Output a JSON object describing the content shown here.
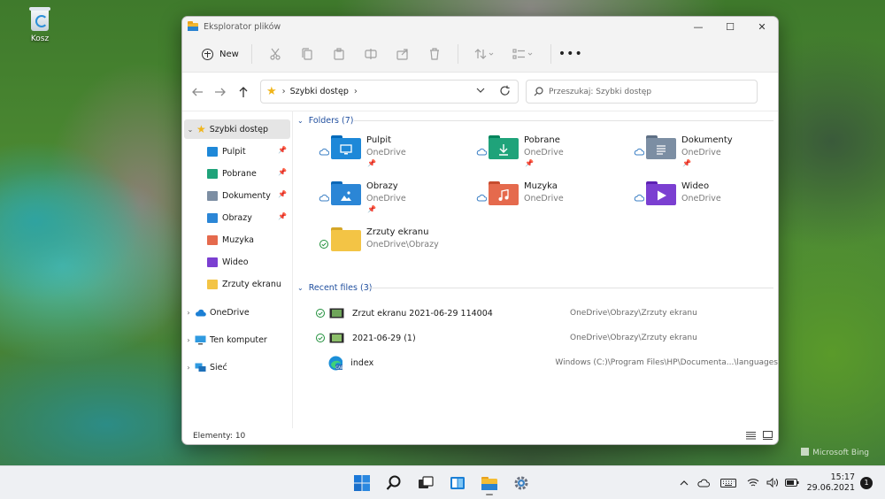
{
  "desktop": {
    "recycle_bin_label": "Kosz",
    "watermark": "Microsoft Bing"
  },
  "window": {
    "title": "Eksplorator plików",
    "controls": {
      "minimize": "—",
      "maximize": "☐",
      "close": "✕"
    }
  },
  "toolbar": {
    "new_label": "New",
    "more_label": "•••",
    "icons": [
      "cut-icon",
      "copy-icon",
      "paste-icon",
      "rename-icon",
      "share-icon",
      "delete-icon",
      "sort-icon",
      "view-icon"
    ]
  },
  "address": {
    "crumb": "Szybki dostęp",
    "search_placeholder": "Przeszukaj: Szybki dostęp"
  },
  "sidebar": {
    "quick_access": "Szybki dostęp",
    "items": [
      {
        "label": "Pulpit",
        "color": "#1e88d8",
        "pinned": true
      },
      {
        "label": "Pobrane",
        "color": "#1fa37a",
        "pinned": true
      },
      {
        "label": "Dokumenty",
        "color": "#7c8ea3",
        "pinned": true
      },
      {
        "label": "Obrazy",
        "color": "#2b86d6",
        "pinned": true
      },
      {
        "label": "Muzyka",
        "color": "#e56a4d",
        "pinned": false
      },
      {
        "label": "Wideo",
        "color": "#7b3fd1",
        "pinned": false
      },
      {
        "label": "Zrzuty ekranu",
        "color": "#f3c445",
        "pinned": false
      }
    ],
    "onedrive": "OneDrive",
    "computer": "Ten komputer",
    "network": "Sieć"
  },
  "folders": {
    "header": "Folders (7)",
    "items": [
      {
        "name": "Pulpit",
        "location": "OneDrive",
        "color": "#1e88d8",
        "glyph": "desktop",
        "pinned": true,
        "status": "cloud"
      },
      {
        "name": "Pobrane",
        "location": "OneDrive",
        "color": "#1fa37a",
        "glyph": "download",
        "pinned": true,
        "status": "cloud"
      },
      {
        "name": "Dokumenty",
        "location": "OneDrive",
        "color": "#7c8ea3",
        "glyph": "document",
        "pinned": true,
        "status": "cloud"
      },
      {
        "name": "Obrazy",
        "location": "OneDrive",
        "color": "#2b86d6",
        "glyph": "picture",
        "pinned": true,
        "status": "cloud"
      },
      {
        "name": "Muzyka",
        "location": "OneDrive",
        "color": "#e56a4d",
        "glyph": "music",
        "pinned": false,
        "status": "cloud"
      },
      {
        "name": "Wideo",
        "location": "OneDrive",
        "color": "#7b3fd1",
        "glyph": "video",
        "pinned": false,
        "status": "cloud"
      },
      {
        "name": "Zrzuty ekranu",
        "location": "OneDrive\\Obrazy",
        "color": "#f3c445",
        "glyph": "none",
        "pinned": false,
        "status": "synced"
      }
    ]
  },
  "recent": {
    "header": "Recent files (3)",
    "items": [
      {
        "name": "Zrzut ekranu 2021-06-29 114004",
        "location": "OneDrive\\Obrazy\\Zrzuty ekranu",
        "status": "synced"
      },
      {
        "name": "2021-06-29 (1)",
        "location": "OneDrive\\Obrazy\\Zrzuty ekranu",
        "status": "synced"
      },
      {
        "name": "index",
        "location": "Windows (C:)\\Program Files\\HP\\Documenta...\\languages",
        "status": "none"
      }
    ]
  },
  "status": {
    "count": "Elementy: 10"
  },
  "taskbar": {
    "time": "15:17",
    "date": "29.06.2021",
    "notifications": "1"
  }
}
